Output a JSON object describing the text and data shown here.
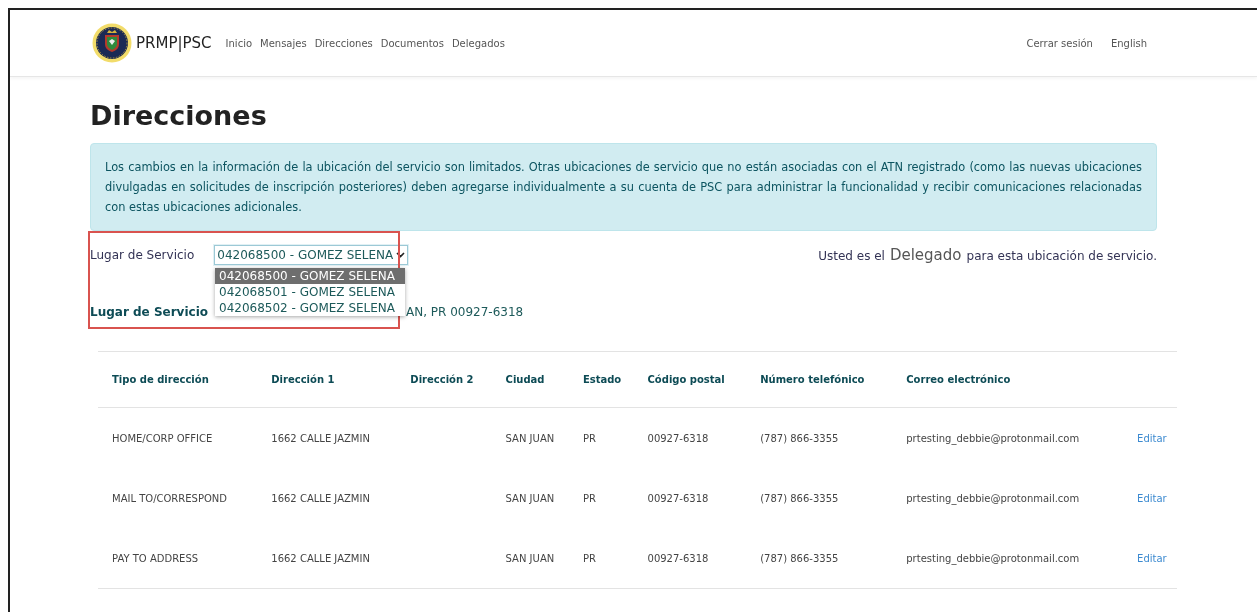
{
  "navbar": {
    "brand": "PRMP|PSC",
    "links": [
      {
        "label": "Inicio"
      },
      {
        "label": "Mensajes"
      },
      {
        "label": "Direcciones"
      },
      {
        "label": "Documentos"
      },
      {
        "label": "Delegados"
      }
    ],
    "right_links": [
      {
        "label": "Cerrar sesión"
      },
      {
        "label": "English"
      }
    ]
  },
  "title": "Direcciones",
  "alert": "Los cambios en la información de la ubicación del servicio son limitados. Otras ubicaciones de servicio que no están asociadas con el ATN registrado (como las nuevas ubicaciones divulgadas en solicitudes de inscripción posteriores) deben agregarse individualmente a su cuenta de PSC para administrar la funcionalidad y recibir comunicaciones relacionadas con estas ubicaciones adicionales.",
  "service_select": {
    "label": "Lugar de Servicio",
    "value": "042068500 - GOMEZ SELENA",
    "expanded": true,
    "options": [
      {
        "label": "042068500 - GOMEZ SELENA",
        "selected": true
      },
      {
        "label": "042068501 - GOMEZ SELENA",
        "selected": false
      },
      {
        "label": "042068502 - GOMEZ SELENA",
        "selected": false
      }
    ]
  },
  "role_note": {
    "prefix": "Usted es el",
    "role": "Delegado",
    "suffix": "para esta ubicación de servicio."
  },
  "service_address": {
    "label": "Lugar de Servicio",
    "value": "AN, PR 00927-6318"
  },
  "table": {
    "columns": [
      "Tipo de dirección",
      "Dirección 1",
      "Dirección 2",
      "Ciudad",
      "Estado",
      "Código postal",
      "Número telefónico",
      "Correo electrónico"
    ],
    "rows": [
      {
        "cells": [
          "HOME/CORP OFFICE",
          "1662 CALLE JAZMIN",
          "",
          "SAN JUAN",
          "PR",
          "00927-6318",
          "(787) 866-3355",
          "prtesting_debbie@protonmail.com"
        ],
        "action": "Editar"
      },
      {
        "cells": [
          "MAIL TO/CORRESPOND",
          "1662 CALLE JAZMIN",
          "",
          "SAN JUAN",
          "PR",
          "00927-6318",
          "(787) 866-3355",
          "prtesting_debbie@protonmail.com"
        ],
        "action": "Editar"
      },
      {
        "cells": [
          "PAY TO ADDRESS",
          "1662 CALLE JAZMIN",
          "",
          "SAN JUAN",
          "PR",
          "00927-6318",
          "(787) 866-3355",
          "prtesting_debbie@protonmail.com"
        ],
        "action": "Editar"
      }
    ]
  }
}
